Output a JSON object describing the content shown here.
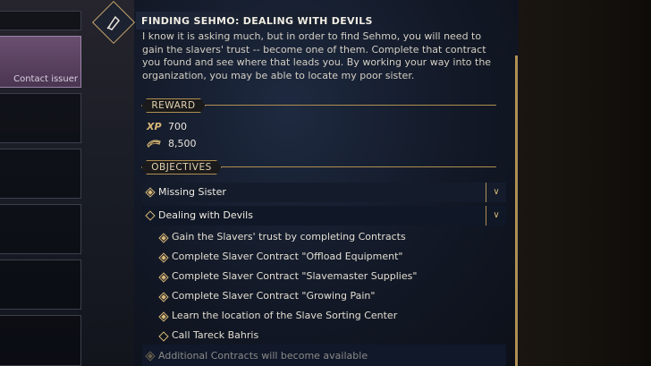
{
  "quest_list": {
    "active_item_label": "Contact issuer"
  },
  "quest": {
    "title": "FINDING SEHMO: DEALING WITH DEVILS",
    "description": "I know it is asking much, but in order to find Sehmo, you will need to gain the slavers' trust -- become one of them. Complete that contract you found and see where that leads you. By working your way into the organization, you may be able to locate my poor sister."
  },
  "reward": {
    "section_label": "REWARD",
    "xp_label": "XP",
    "xp_value": "700",
    "money_icon": "coins-icon",
    "money_value": "8,500"
  },
  "objectives": {
    "section_label": "OBJECTIVES",
    "groups": [
      {
        "label": "Missing Sister",
        "state": "in-progress",
        "expand_icon": "chevron-down-icon"
      },
      {
        "label": "Dealing with Devils",
        "state": "open",
        "expand_icon": "chevron-down-icon"
      }
    ],
    "sub_objectives": [
      {
        "label": "Gain the Slavers' trust by completing Contracts",
        "state": "in-progress"
      },
      {
        "label": "Complete Slaver Contract \"Offload Equipment\"",
        "state": "in-progress"
      },
      {
        "label": "Complete Slaver Contract \"Slavemaster Supplies\"",
        "state": "in-progress"
      },
      {
        "label": "Complete Slaver Contract \"Growing Pain\"",
        "state": "in-progress"
      },
      {
        "label": "Learn the location of the Slave Sorting Center",
        "state": "in-progress"
      },
      {
        "label": "Call Tareck Bahris",
        "state": "open"
      }
    ],
    "pending": "Additional Contracts will become available"
  },
  "colors": {
    "accent_gold": "#b08f52",
    "active_slot": "#6a4f70"
  }
}
